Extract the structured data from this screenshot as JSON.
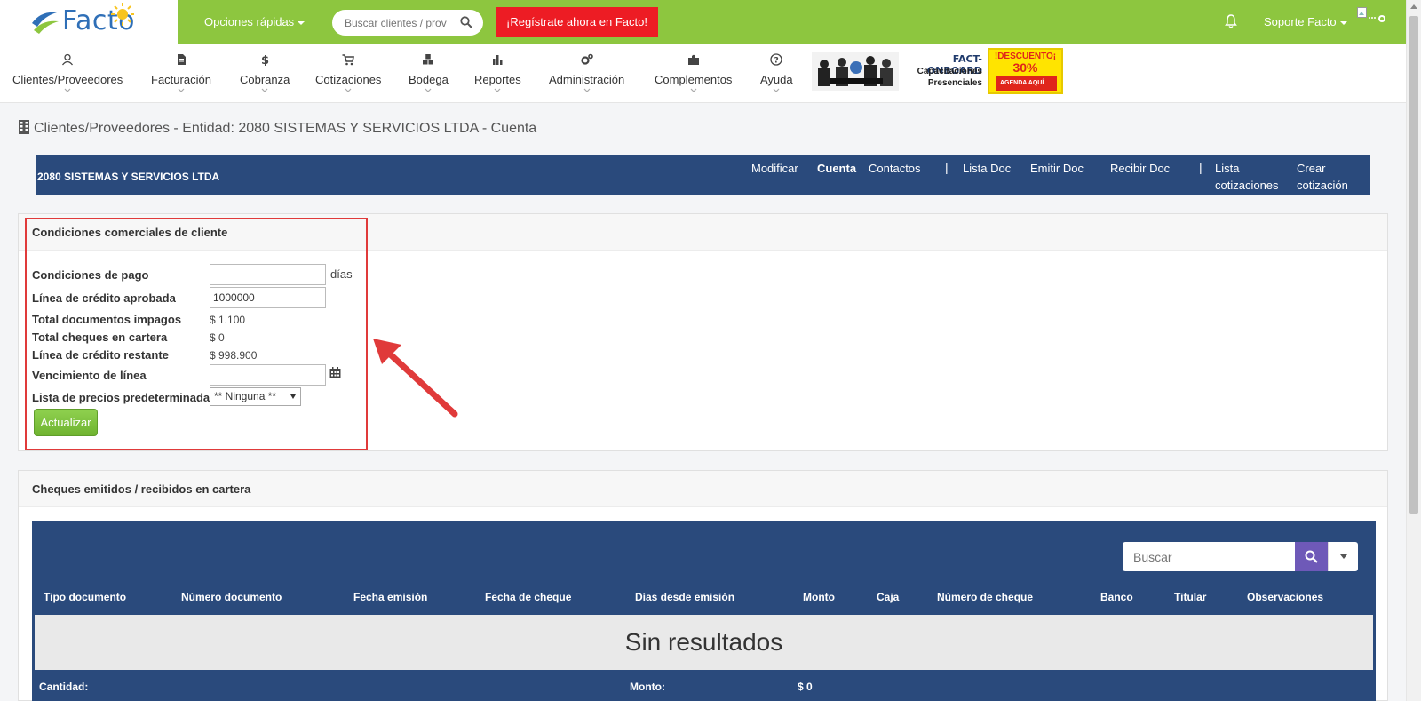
{
  "topbar": {
    "logo_text": "Facto",
    "quick_options": "Opciones rápidas",
    "search_placeholder": "Buscar clientes / prov",
    "register_cta": "¡Regístrate ahora en Facto!",
    "user_name": "Soporte Facto",
    "brand_color": "#8dc63f"
  },
  "nav": {
    "items": [
      {
        "label": "Clientes/Proveedores",
        "icon": "contacts-icon"
      },
      {
        "label": "Facturación",
        "icon": "document-icon"
      },
      {
        "label": "Cobranza",
        "icon": "dollar-icon"
      },
      {
        "label": "Cotizaciones",
        "icon": "cart-icon"
      },
      {
        "label": "Bodega",
        "icon": "boxes-icon"
      },
      {
        "label": "Reportes",
        "icon": "bar-chart-icon"
      },
      {
        "label": "Administración",
        "icon": "gears-icon"
      },
      {
        "label": "Complementos",
        "icon": "puzzle-icon"
      },
      {
        "label": "Ayuda",
        "icon": "help-icon"
      }
    ],
    "banner": {
      "title": "FACT-ONBOARD",
      "line2": "Capacitaciones",
      "line3": "Presenciales",
      "promo_top": "!DESCUENTO¡",
      "promo_pct": "30%",
      "promo_cta": "AGENDA AQUÍ"
    }
  },
  "page": {
    "title": "Clientes/Proveedores - Entidad: 2080 SISTEMAS Y SERVICIOS LTDA - Cuenta"
  },
  "entity": {
    "name": "2080 SISTEMAS Y SERVICIOS LTDA",
    "links": {
      "modificar": "Modificar",
      "cuenta": "Cuenta",
      "contactos": "Contactos",
      "sep": "|",
      "lista_doc": "Lista Doc",
      "emitir_doc": "Emitir Doc",
      "recibir_doc": "Recibir Doc",
      "lista_cot_1": "Lista",
      "lista_cot_2": "cotizaciones",
      "crear_cot_1": "Crear",
      "crear_cot_2": "cotización"
    }
  },
  "conditions": {
    "title": "Condiciones comerciales de cliente",
    "payment_terms_label": "Condiciones de pago",
    "payment_terms_value": "",
    "days_suffix": "días",
    "credit_line_label": "Línea de crédito aprobada",
    "credit_line_value": "1000000",
    "unpaid_docs_label": "Total documentos impagos",
    "unpaid_docs_value": "$ 1.100",
    "cheques_label": "Total cheques en cartera",
    "cheques_value": "$ 0",
    "remaining_label": "Línea de crédito restante",
    "remaining_value": "$ 998.900",
    "expiry_label": "Vencimiento de línea",
    "expiry_value": "",
    "price_list_label": "Lista de precios predeterminada",
    "price_list_value": "** Ninguna **",
    "update_button": "Actualizar",
    "highlight_color": "#e03a3a"
  },
  "cheques": {
    "title": "Cheques emitidos / recibidos en cartera",
    "search_placeholder": "Buscar",
    "columns": [
      "Tipo documento",
      "Número documento",
      "Fecha emisión",
      "Fecha de cheque",
      "Días desde emisión",
      "Monto",
      "Caja",
      "Número de cheque",
      "Banco",
      "Titular",
      "Observaciones"
    ],
    "empty": "Sin resultados",
    "footer_count_label": "Cantidad:",
    "footer_amount_label": "Monto:",
    "footer_amount_value": "$ 0",
    "header_color": "#2a4a7c"
  }
}
